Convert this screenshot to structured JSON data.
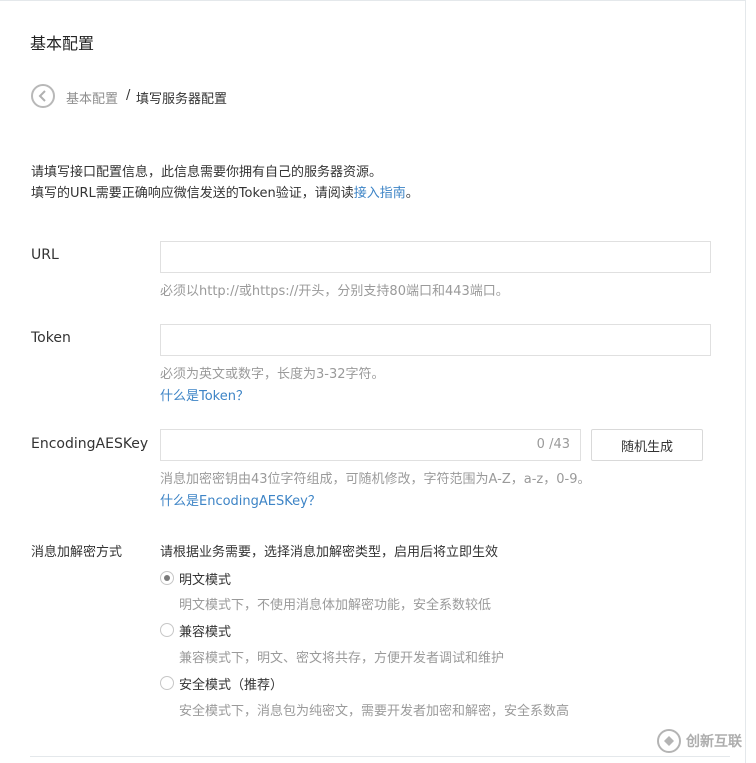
{
  "page": {
    "title": "基本配置"
  },
  "breadcrumb": {
    "parent": "基本配置",
    "separator": "/",
    "current": "填写服务器配置"
  },
  "intro": {
    "line1": "请填写接口配置信息，此信息需要你拥有自己的服务器资源。",
    "line2_prefix": "填写的URL需要正确响应微信发送的Token验证，请阅读",
    "line2_link": "接入指南",
    "line2_suffix": "。"
  },
  "url_field": {
    "label": "URL",
    "value": "",
    "hint": "必须以http://或https://开头，分别支持80端口和443端口。"
  },
  "token_field": {
    "label": "Token",
    "value": "",
    "hint": "必须为英文或数字，长度为3-32字符。",
    "help_link": "什么是Token？"
  },
  "aes_field": {
    "label": "EncodingAESKey",
    "value": "",
    "counter": "0 /43",
    "generate_button": "随机生成",
    "hint": "消息加密密钥由43位字符组成，可随机修改，字符范围为A-Z，a-z，0-9。",
    "help_link": "什么是EncodingAESKey？"
  },
  "encryption": {
    "label": "消息加解密方式",
    "description": "请根据业务需要，选择消息加解密类型，启用后将立即生效",
    "selected": "plain",
    "options": [
      {
        "id": "plain",
        "label": "明文模式",
        "desc": "明文模式下，不使用消息体加解密功能，安全系数较低"
      },
      {
        "id": "compat",
        "label": "兼容模式",
        "desc": "兼容模式下，明文、密文将共存，方便开发者调试和维护"
      },
      {
        "id": "safe",
        "label": "安全模式（推荐）",
        "desc": "安全模式下，消息包为纯密文，需要开发者加密和解密，安全系数高"
      }
    ]
  },
  "watermark": {
    "text": "创新互联"
  },
  "colors": {
    "link": "#3d84c6",
    "hint": "#9a9a9a",
    "border": "#e0e0e0"
  }
}
